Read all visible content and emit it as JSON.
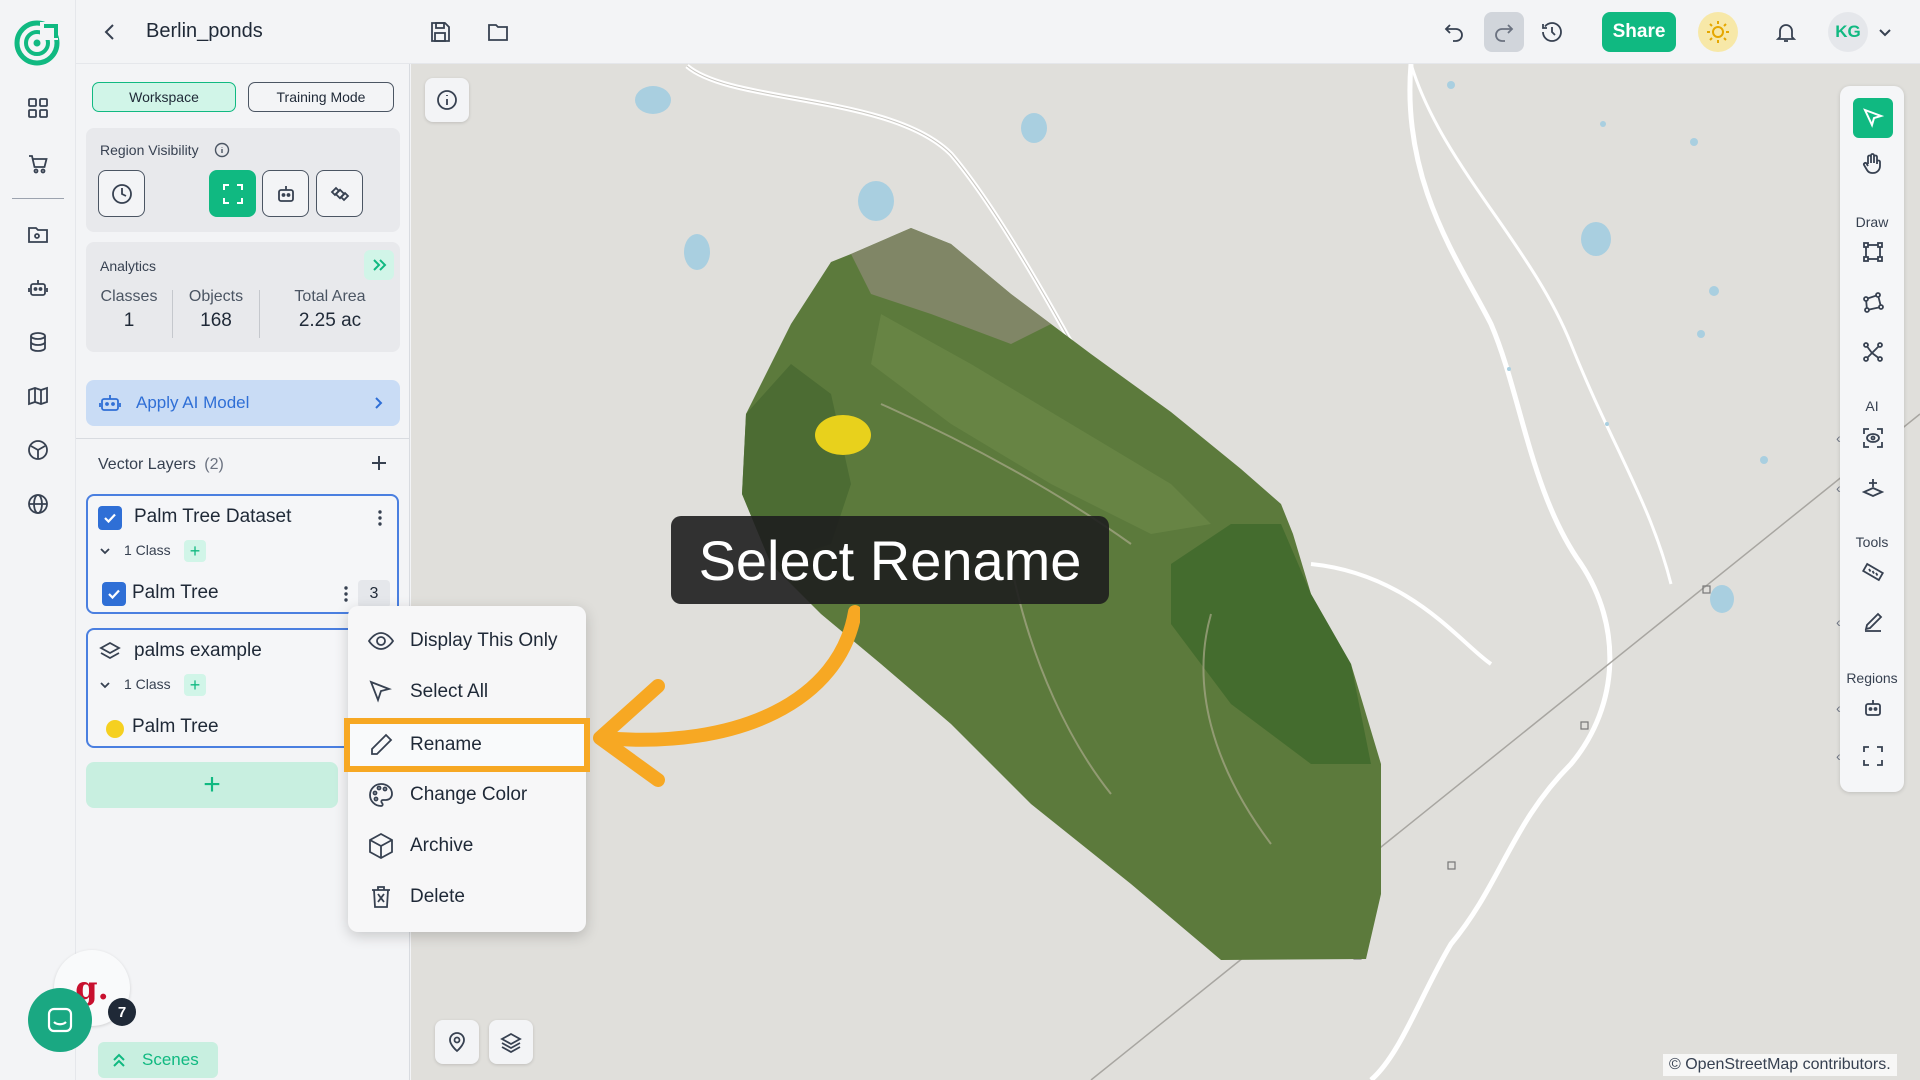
{
  "header": {
    "project_name": "Berlin_ponds",
    "share_label": "Share",
    "user_initials": "KG"
  },
  "panel": {
    "mode_tabs": [
      "Workspace",
      "Training Mode"
    ],
    "region_visibility_label": "Region Visibility",
    "analytics_label": "Analytics",
    "stats": [
      {
        "label": "Classes",
        "value": "1"
      },
      {
        "label": "Objects",
        "value": "168"
      },
      {
        "label": "Total Area",
        "value": "2.25 ac"
      }
    ],
    "apply_ai_label": "Apply AI Model",
    "vector_layers_label": "Vector Layers",
    "vector_layers_count": "(2)",
    "layers": [
      {
        "name": "Palm Tree Dataset",
        "class_count": "1 Class",
        "class_name": "Palm Tree",
        "class_badge": "3",
        "class_color": "#2f6fd6"
      },
      {
        "name": "palms example",
        "class_count": "1 Class",
        "class_name": "Palm Tree",
        "class_color": "#f5d020"
      }
    ],
    "add_layer_label": "+",
    "scenes_label": "Scenes",
    "chat_badge": "7",
    "brand_letter": "g."
  },
  "context_menu": {
    "items": [
      {
        "label": "Display This Only",
        "icon": "eye-icon"
      },
      {
        "label": "Select All",
        "icon": "cursor-icon"
      },
      {
        "label": "Rename",
        "icon": "pencil-icon"
      },
      {
        "label": "Change Color",
        "icon": "palette-icon"
      },
      {
        "label": "Archive",
        "icon": "box-icon"
      },
      {
        "label": "Delete",
        "icon": "trash-icon"
      }
    ],
    "highlighted": "Rename"
  },
  "tooltip": {
    "text": "Select Rename"
  },
  "toolrail": {
    "sections": [
      "Draw",
      "AI",
      "Tools",
      "Regions"
    ]
  },
  "map": {
    "attribution": "© OpenStreetMap contributors."
  },
  "colors": {
    "accent": "#10b981",
    "highlight": "#f7a823",
    "layer_border": "#4a7fe0"
  }
}
